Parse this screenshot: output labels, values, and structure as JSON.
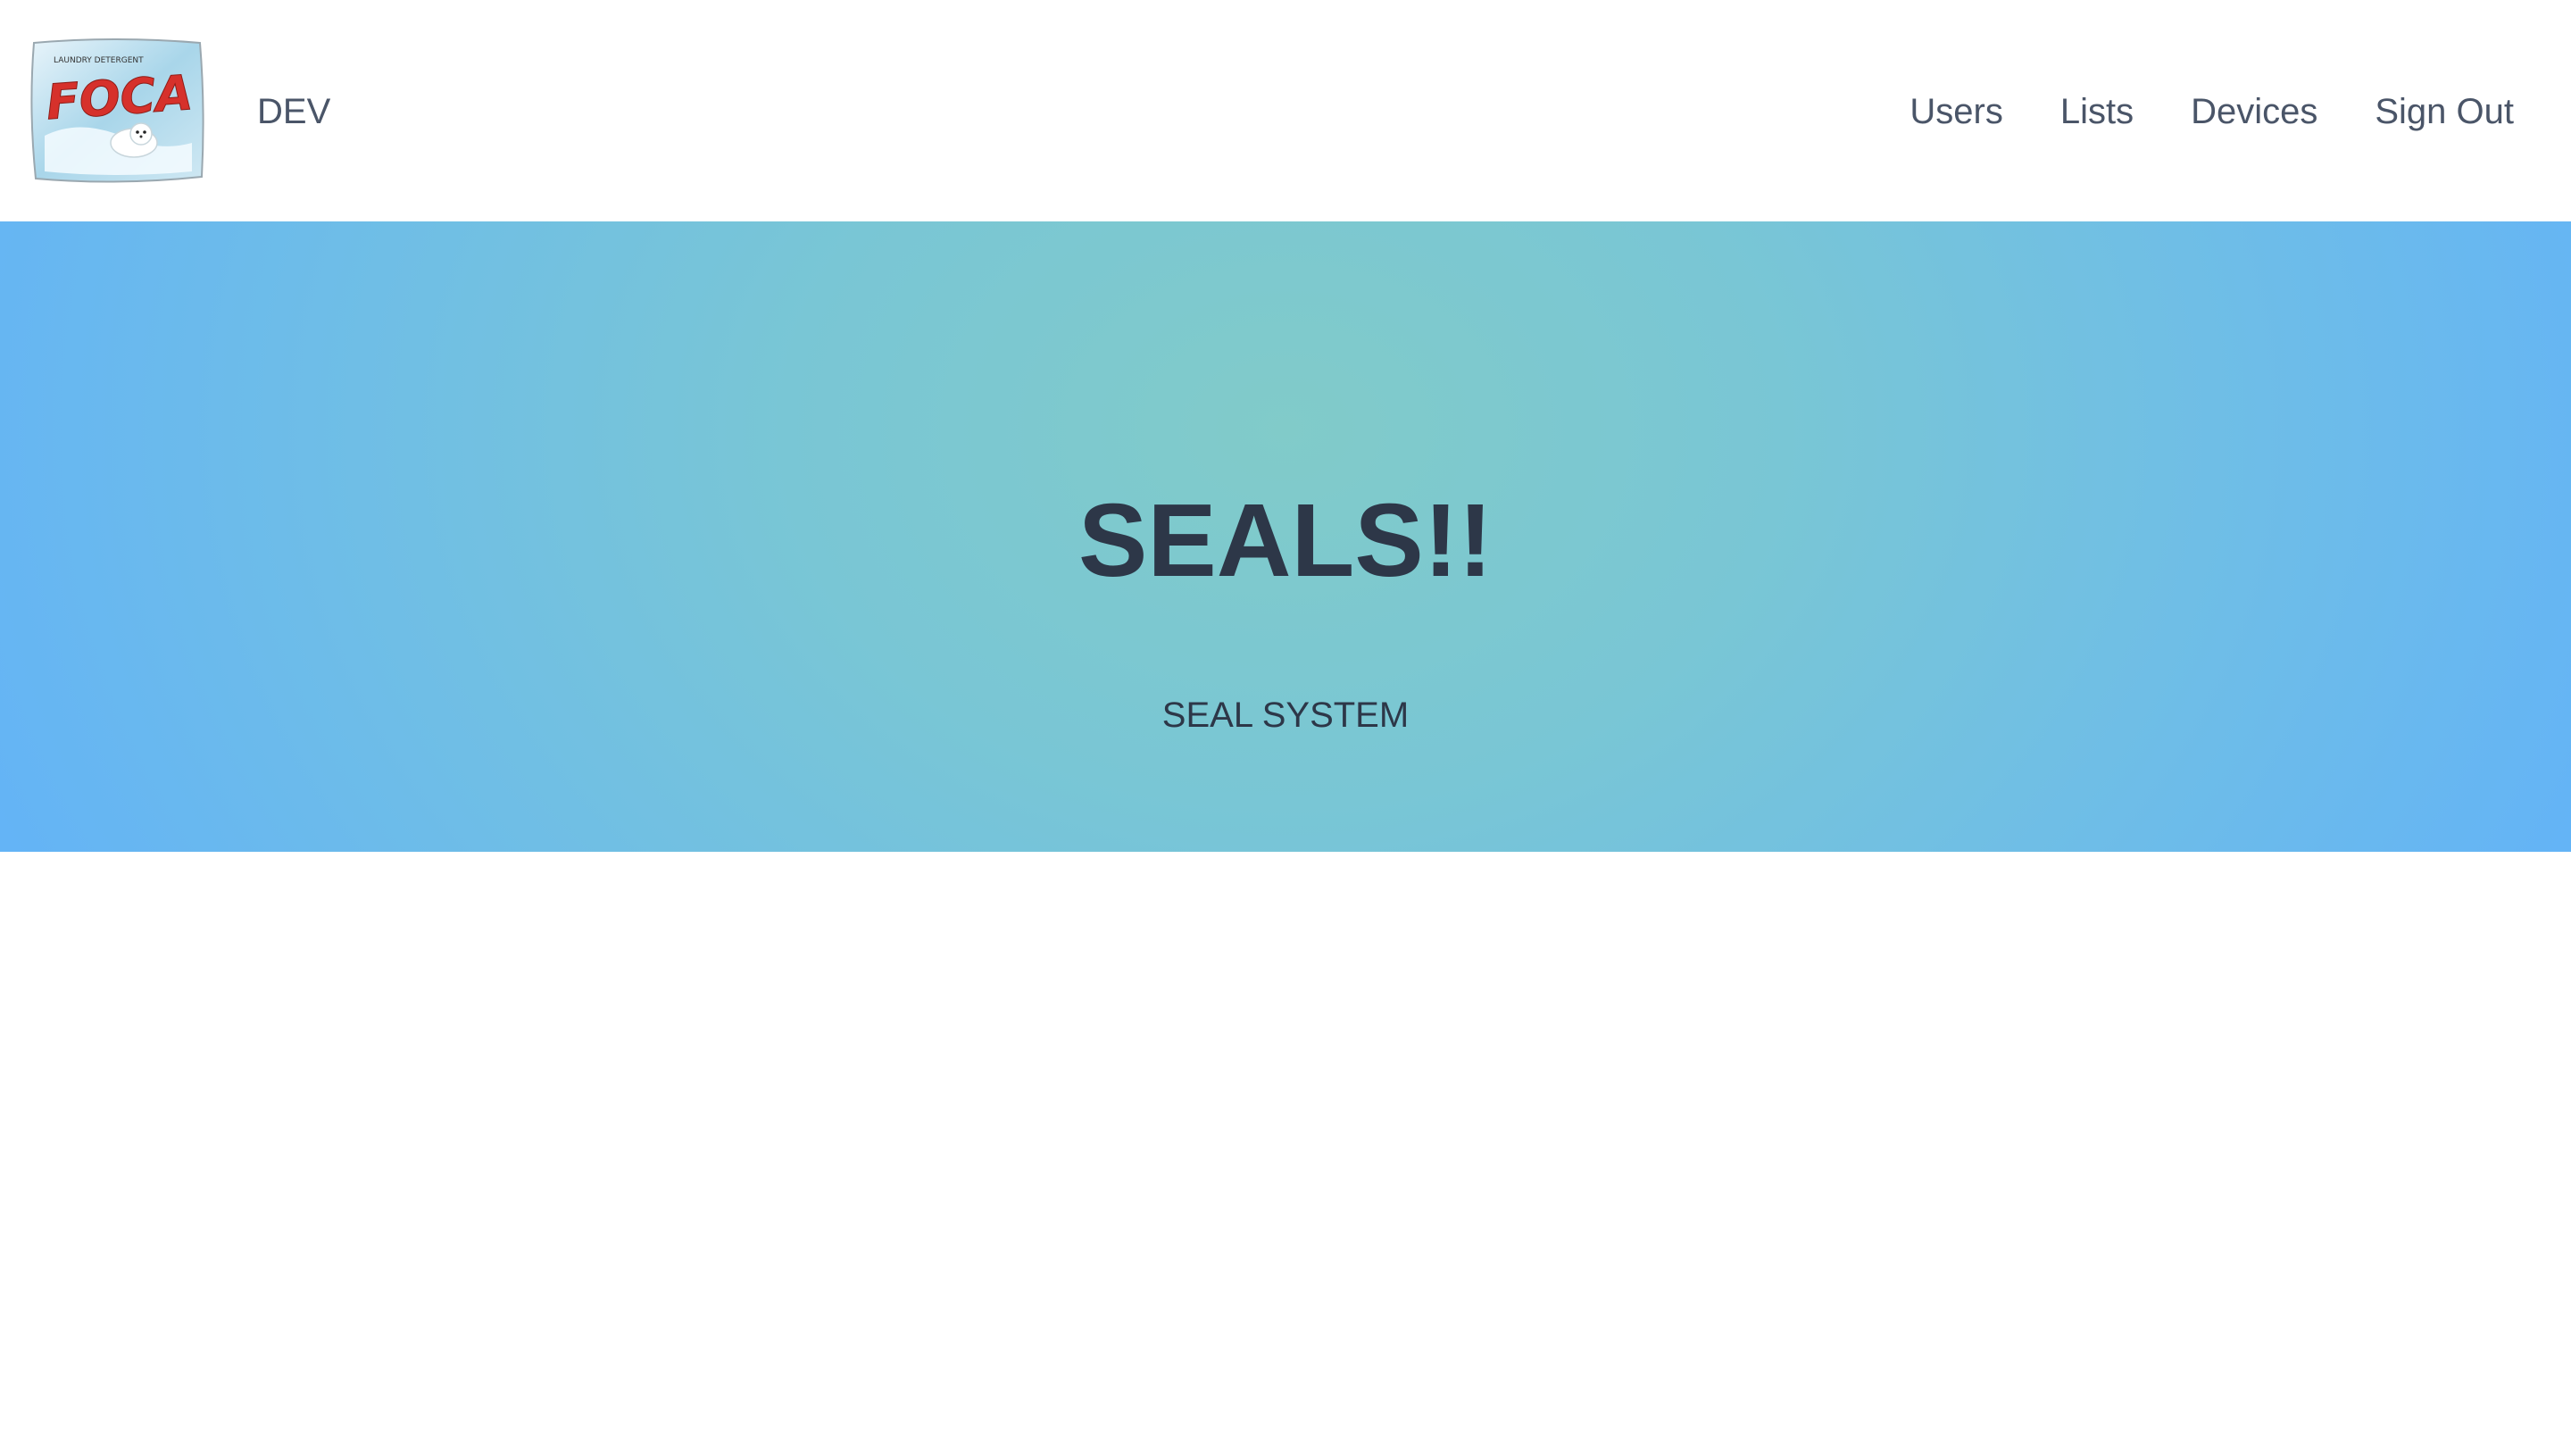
{
  "header": {
    "logo_icon": "foca-detergent-logo",
    "logo_text": "FOCA",
    "logo_small_text": "LAUNDRY DETERGENT",
    "brand": "DEV",
    "nav": {
      "users": "Users",
      "lists": "Lists",
      "devices": "Devices",
      "sign_out": "Sign Out"
    }
  },
  "hero": {
    "title": "SEALS!!",
    "subtitle": "SEAL SYSTEM"
  },
  "colors": {
    "text": "#4a5568",
    "heading": "#2d3748",
    "hero_center": "#81cbc9",
    "hero_edge": "#63b3f7",
    "logo_red": "#d6312b"
  }
}
